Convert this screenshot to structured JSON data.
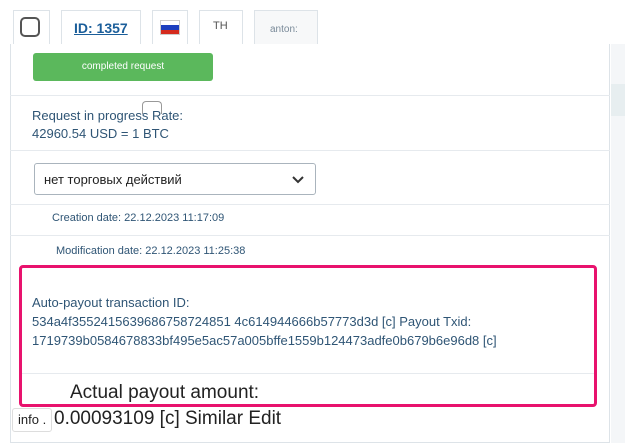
{
  "header": {
    "id_label": "ID: 1357",
    "lang_code": "TH",
    "user": "anton:"
  },
  "status_button": "completed request",
  "rate": {
    "line1": "Request in progress Rate:",
    "line2": "42960.54 USD = 1 BTC"
  },
  "trade_select": {
    "value": "нет торговых действий"
  },
  "dates": {
    "creation": "Creation date: 22.12.2023 11:17:09",
    "modification": "Modification date: 22.12.2023 11:25:38"
  },
  "payout": {
    "label": "Auto-payout transaction ID:",
    "line1": "534a4f3552415639686758724851 4c614944666b57773d3d [c] Payout Txid:",
    "line2": "1719739b0584678833bf495e5ac57a005bffe1559b124473adfe0b679b6e96d8 [c]"
  },
  "overlay": {
    "actual_label": "Actual payout amount:",
    "info_badge": "info .",
    "amount_line": "0.00093109 [c] Similar Edit"
  },
  "colors": {
    "accent_green": "#5bb85c",
    "highlight_pink": "#e8126d",
    "link_blue": "#1b5e9a"
  }
}
